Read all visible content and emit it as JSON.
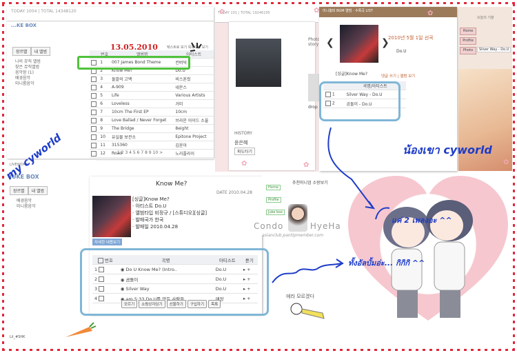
{
  "colors": {
    "red": "#e0283a",
    "blue": "#1e3cc8",
    "green": "#4fc33b",
    "brand": "#6a8ab8"
  },
  "jukebox": {
    "title": "...KE BOX",
    "topbar": "TODAY 1004 | TOTAL 14348120",
    "tabs": [
      "장르별",
      "내 앨범"
    ],
    "sidebar": [
      "나의 뮤직 앨범",
      "찾은 뮤직앨범",
      "음악함 (1)",
      "배경음악",
      "미니룸음악"
    ],
    "date": "13.05.2010",
    "options": [
      "텍스트로 보기",
      "목록으로 보기"
    ],
    "columns": [
      "번호",
      "앨범명",
      "아티스트"
    ],
    "rows": [
      {
        "no": "1",
        "album": "007 James Bond Theme",
        "artist": "컨버덕"
      },
      {
        "no": "2",
        "album": "Know Me?",
        "artist": "Do.U"
      },
      {
        "no": "3",
        "album": "돌발의 고백",
        "artist": "비스혼컷"
      },
      {
        "no": "4",
        "album": "A-909",
        "artist": "네온스"
      },
      {
        "no": "5",
        "album": "Life",
        "artist": "Various Artists"
      },
      {
        "no": "6",
        "album": "Loveless",
        "artist": "거미"
      },
      {
        "no": "7",
        "album": "10cm The First EP",
        "artist": "10cm"
      },
      {
        "no": "8",
        "album": "Love Ballad / Never Forget",
        "artist": "브라운 아이드 소울"
      },
      {
        "no": "9",
        "album": "The Bridge",
        "artist": "8eight"
      },
      {
        "no": "10",
        "album": "유실물 보관소",
        "artist": "Epitone Project"
      },
      {
        "no": "11",
        "album": "315360",
        "artist": "김윤아"
      },
      {
        "no": "12",
        "album": "Road",
        "artist": "노리플라이"
      }
    ],
    "pager": "1 2 3 4 5 6 7 8 9 10 >"
  },
  "middle": {
    "topbar": "TODAY 101 | TOTAL 19246195",
    "section": "Photo story",
    "label1": "HISTORY",
    "name": "윤은혜",
    "link": "파도타기",
    "caption": "drop"
  },
  "bgm": {
    "header": "미니홈피 BGM 앨범 · 수록곡 LIST",
    "date": "2010년 5월 1일 선곡",
    "caption": "[싱글]Know Me?",
    "artist": "Do.U",
    "columns": [
      "곡명/아티스트"
    ],
    "rows": [
      {
        "no": "1",
        "title": "Silver Way - Do.U"
      },
      {
        "no": "2",
        "title": "곰돌이 - Do.U"
      }
    ],
    "links": [
      "댓글 쓰기",
      "앨범 보기"
    ]
  },
  "right": {
    "menu": [
      "Home",
      "Profile",
      "Photo"
    ],
    "nowplaying": "Silver Way - Do.U",
    "label": "오늘의 기분"
  },
  "bottom_left": {
    "brand": "LIVEWORK",
    "title": "JUKE BOX",
    "tabs": [
      "장르별",
      "내 앨범"
    ],
    "sidebar": [
      "배경음악",
      "미니룸음악"
    ],
    "footer": "Lil_#SHK"
  },
  "know_me": {
    "title": "Know Me?",
    "date_label": "DATE",
    "date": "2010.04.28",
    "info": [
      "[싱글]Know Me?",
      "· 아티스트 Do.U",
      "· 앨범타입 비정규 / [스튜디오][싱글]",
      "· 발매국가 한국",
      "· 발매일 2010.04.28"
    ],
    "cover_btn": "자세한 내용보기",
    "columns": [
      "번호",
      "곡명",
      "아티스트",
      "듣기"
    ],
    "rows": [
      {
        "no": "1",
        "title": "Do U Know Me? (Intro..",
        "artist": "Do.U"
      },
      {
        "no": "2",
        "title": "곰돌이",
        "artist": "Do.U"
      },
      {
        "no": "3",
        "title": "Silver Way",
        "artist": "Do.U"
      },
      {
        "no": "4",
        "title": "am 5:33 Do.U를 만든 사람들..",
        "artist": "매장"
      }
    ],
    "buttons": [
      "모르기",
      "쇼핑상자담기",
      "선물하기",
      "구입하기",
      "목록"
    ]
  },
  "menu7": {
    "tabs": [
      "추천미니엄",
      "소왕보기"
    ],
    "items": [
      "Home",
      "Profile",
      "Juke box"
    ]
  },
  "watermark": {
    "line1": "Condo",
    "line2": "HyeHa",
    "url": "asianclub.pantipmember.com"
  },
  "annotations": {
    "my": "my cyworld",
    "his": "น้องเขา cyworld",
    "note1": "แค่ 2 เพลงอะ ^^",
    "note2": "ทั้งอัลบั้มอ่ะ... กิกิกิ ^^",
    "doodle": "에라 모르겠다"
  }
}
